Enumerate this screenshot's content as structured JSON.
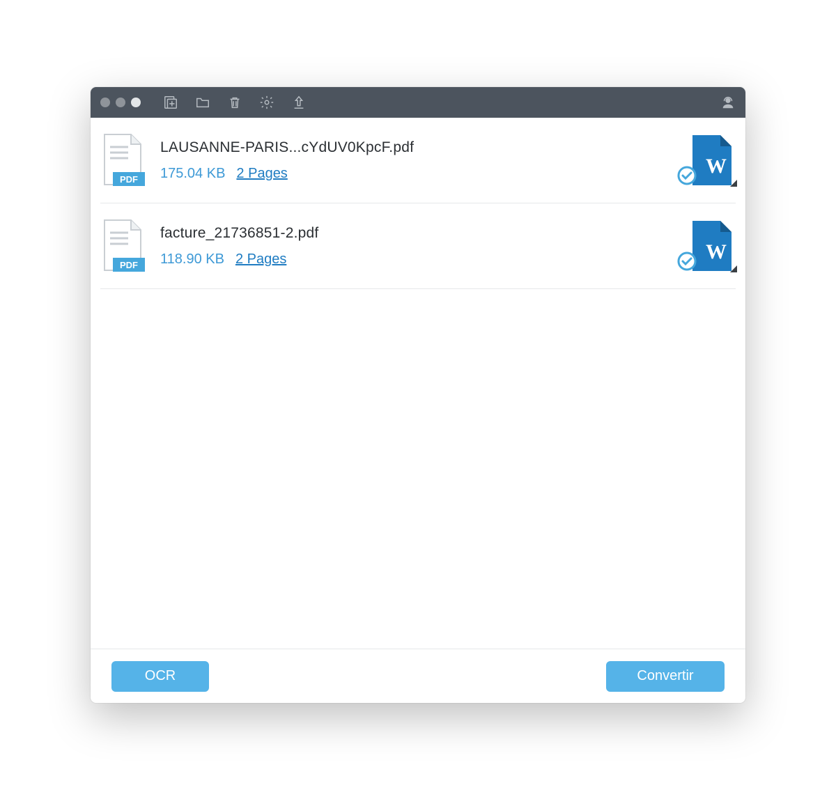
{
  "files": [
    {
      "name": "LAUSANNE-PARIS...cYdUV0KpcF.pdf",
      "size": "175.04 KB",
      "pages": "2 Pages"
    },
    {
      "name": "facture_21736851-2.pdf",
      "size": "118.90 KB",
      "pages": "2 Pages"
    }
  ],
  "footer": {
    "ocr_label": "OCR",
    "convert_label": "Convertir"
  },
  "icons": {
    "add_file": "add-file-icon",
    "add_folder": "folder-icon",
    "delete": "trash-icon",
    "settings": "gear-icon",
    "export": "upload-icon",
    "support": "support-agent-icon",
    "pdf": "pdf-file-icon",
    "word": "word-file-icon",
    "check": "check-badge-icon"
  },
  "colors": {
    "titlebar": "#4c545e",
    "accent": "#55b3e8",
    "link": "#1f7cc2",
    "size_text": "#3d99d6",
    "word_blue": "#1f7cc2"
  }
}
